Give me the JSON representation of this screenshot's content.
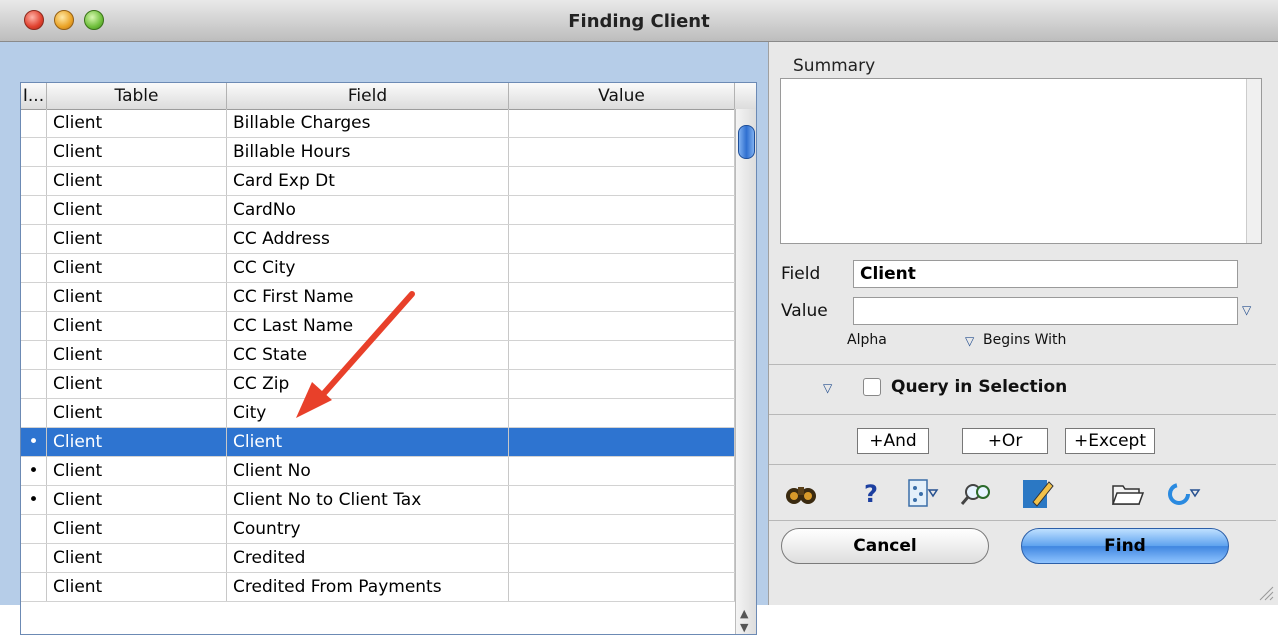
{
  "window": {
    "title": "Finding Client"
  },
  "table": {
    "columns": [
      "I...",
      "Table",
      "Field",
      "Value"
    ],
    "rows": [
      {
        "mark": "",
        "table": "Client",
        "field": "Billable Charges",
        "value": ""
      },
      {
        "mark": "",
        "table": "Client",
        "field": "Billable Hours",
        "value": ""
      },
      {
        "mark": "",
        "table": "Client",
        "field": "Card Exp Dt",
        "value": ""
      },
      {
        "mark": "",
        "table": "Client",
        "field": "CardNo",
        "value": ""
      },
      {
        "mark": "",
        "table": "Client",
        "field": "CC Address",
        "value": ""
      },
      {
        "mark": "",
        "table": "Client",
        "field": "CC City",
        "value": ""
      },
      {
        "mark": "",
        "table": "Client",
        "field": "CC First Name",
        "value": ""
      },
      {
        "mark": "",
        "table": "Client",
        "field": "CC Last Name",
        "value": ""
      },
      {
        "mark": "",
        "table": "Client",
        "field": "CC State",
        "value": ""
      },
      {
        "mark": "",
        "table": "Client",
        "field": "CC Zip",
        "value": ""
      },
      {
        "mark": "",
        "table": "Client",
        "field": "City",
        "value": ""
      },
      {
        "mark": "•",
        "table": "Client",
        "field": "Client",
        "value": "",
        "selected": true
      },
      {
        "mark": "•",
        "table": "Client",
        "field": "Client No",
        "value": ""
      },
      {
        "mark": "•",
        "table": "Client",
        "field": "Client No to Client Tax",
        "value": ""
      },
      {
        "mark": "",
        "table": "Client",
        "field": "Country",
        "value": ""
      },
      {
        "mark": "",
        "table": "Client",
        "field": "Credited",
        "value": ""
      },
      {
        "mark": "",
        "table": "Client",
        "field": "Credited From Payments",
        "value": ""
      }
    ]
  },
  "summary": {
    "label": "Summary"
  },
  "criteria": {
    "field_label": "Field",
    "field_value": "Client",
    "value_label": "Value",
    "value_value": "",
    "type_label": "Alpha",
    "operator_label": "Begins With"
  },
  "query_in_selection": {
    "label": "Query in Selection",
    "checked": false
  },
  "logic_buttons": {
    "and": "+And",
    "or": "+Or",
    "except": "+Except"
  },
  "toolbar_icons": [
    "binoculars-icon",
    "help-icon",
    "formula-icon",
    "search-field-icon",
    "edit-icon",
    "open-folder-icon",
    "refresh-icon"
  ],
  "help_glyph": "?",
  "actions": {
    "cancel": "Cancel",
    "find": "Find"
  },
  "colors": {
    "selection": "#2e74d0",
    "left_panel": "#b6cde8",
    "find_button": "#5ea2ef",
    "annotation_arrow": "#e8402a"
  }
}
